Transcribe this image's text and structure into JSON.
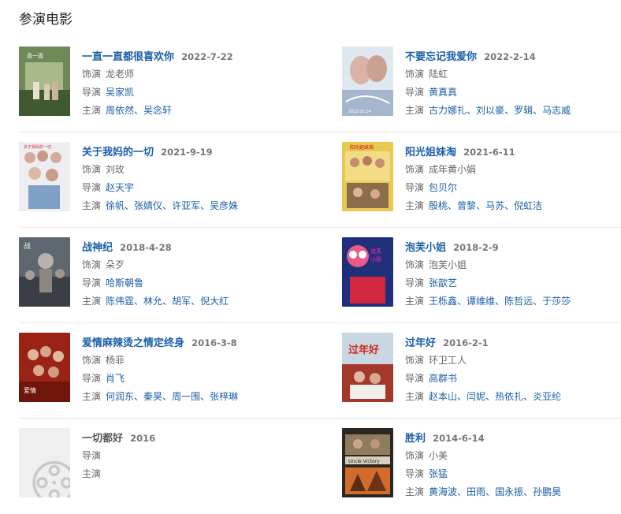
{
  "section": {
    "title": "参演电影"
  },
  "labels": {
    "role": "饰演",
    "director": "导演",
    "cast": "主演"
  },
  "movies": [
    {
      "title": "一直一直都很喜欢你",
      "date": "2022-7-22",
      "role": "龙老师",
      "director": "吴家凯",
      "cast": [
        "周依然",
        "吴念轩"
      ]
    },
    {
      "title": "不要忘记我爱你",
      "date": "2022-2-14",
      "role": "陆虹",
      "director": "黄真真",
      "cast": [
        "古力娜扎",
        "刘以豪",
        "罗辑",
        "马志威"
      ]
    },
    {
      "title": "关于我妈的一切",
      "date": "2021-9-19",
      "role": "刘玫",
      "director": "赵天宇",
      "cast": [
        "徐帆",
        "张婧仪",
        "许亚军",
        "吴彦姝"
      ]
    },
    {
      "title": "阳光姐妹淘",
      "date": "2021-6-11",
      "role": "成年黄小娟",
      "director": "包贝尔",
      "cast": [
        "殷桃",
        "曾黎",
        "马苏",
        "倪虹洁"
      ]
    },
    {
      "title": "战神纪",
      "date": "2018-4-28",
      "role": "朵歹",
      "director": "哈斯朝鲁",
      "cast": [
        "陈伟霆",
        "林允",
        "胡军",
        "倪大红"
      ]
    },
    {
      "title": "泡芙小姐",
      "date": "2018-2-9",
      "role": "泡芙小姐",
      "director": "张歆艺",
      "cast": [
        "王栎鑫",
        "谭维维",
        "陈哲远",
        "于莎莎"
      ]
    },
    {
      "title": "爱情麻辣烫之情定终身",
      "date": "2016-3-8",
      "role": "杨菲",
      "director": "肖飞",
      "cast": [
        "何润东",
        "秦昊",
        "周一围",
        "张梓琳"
      ]
    },
    {
      "title": "过年好",
      "date": "2016-2-1",
      "role": "环卫工人",
      "director": "高群书",
      "cast": [
        "赵本山",
        "闫妮",
        "热依扎",
        "炎亚纶"
      ]
    },
    {
      "title": "一切都好",
      "date": "2016",
      "role": "",
      "director": "",
      "cast": [],
      "no_poster": true
    },
    {
      "title": "胜利",
      "date": "2014-6-14",
      "role": "小美",
      "director": "张猛",
      "cast": [
        "黄海波",
        "田雨",
        "国永振",
        "孙鹏昊"
      ]
    }
  ],
  "colors": {
    "link": "#1a5fa8",
    "divider": "#e8e8e8"
  },
  "icons": {
    "placeholder": "film-reel-icon"
  }
}
